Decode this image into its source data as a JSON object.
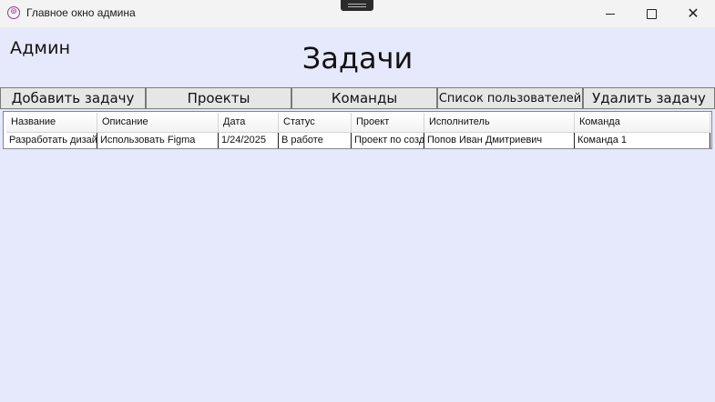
{
  "window": {
    "title": "Главное окно админа",
    "app_icon": "app-logo-icon",
    "controls": {
      "minimize_icon": "minimize-icon",
      "maximize_icon": "maximize-icon",
      "close_icon": "close-icon",
      "close_glyph": "✕"
    }
  },
  "header": {
    "user_label": "Админ",
    "title": "Задачи"
  },
  "toolbar": {
    "add_task": "Добавить задачу",
    "projects": "Проекты",
    "teams": "Команды",
    "users_list": "Список пользователей",
    "delete_task": "Удалить задачу"
  },
  "table": {
    "columns": [
      "Название",
      "Описание",
      "Дата",
      "Статус",
      "Проект",
      "Исполнитель",
      "Команда"
    ],
    "rows": [
      [
        "Разработать дизайн",
        "Использовать Figma",
        "1/24/2025",
        "В работе",
        "Проект по созданию",
        "Попов Иван Дмитриевич",
        "Команда 1"
      ]
    ]
  },
  "colors": {
    "window_background": "#e6e8fb",
    "titlebar": "#f3f3f3",
    "button_background": "#e6e6e6",
    "app_icon": "#a0358f"
  }
}
